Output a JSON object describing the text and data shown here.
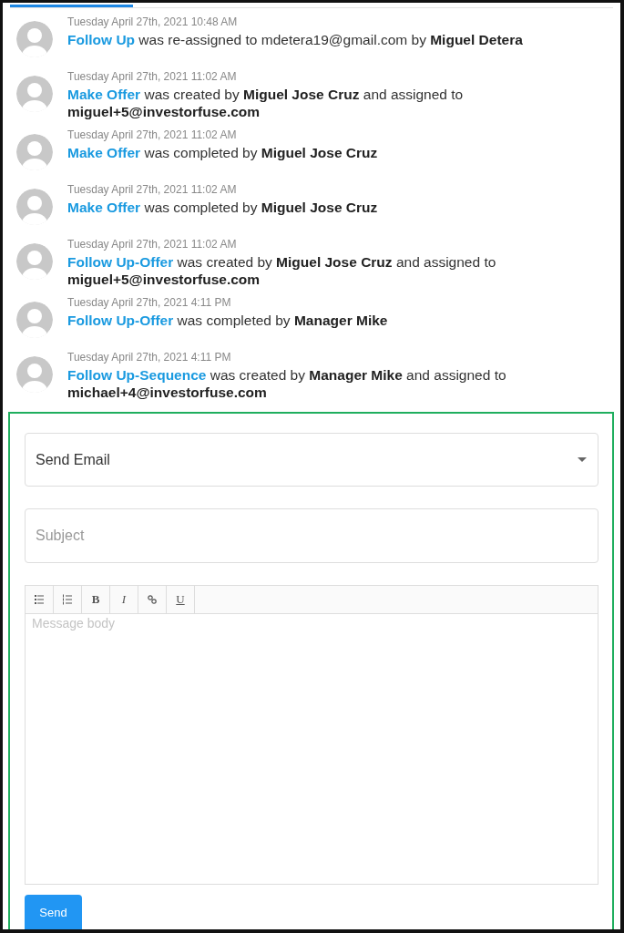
{
  "tab_indicator": {
    "selected": true
  },
  "activity": [
    {
      "time": "Tuesday April 27th, 2021 10:48 AM",
      "task": "Follow Up",
      "text": " was re-assigned to mdetera19@gmail.com by **Miguel Detera**"
    },
    {
      "time": "Tuesday April 27th, 2021 11:02 AM",
      "task": "Make Offer",
      "text": " was created by **Miguel Jose Cruz** and assigned to **miguel+5@investorfuse.com**"
    },
    {
      "time": "Tuesday April 27th, 2021 11:02 AM",
      "task": "Make Offer",
      "text": " was completed by **Miguel Jose Cruz**"
    },
    {
      "time": "Tuesday April 27th, 2021 11:02 AM",
      "task": "Make Offer",
      "text": " was completed by **Miguel Jose Cruz**"
    },
    {
      "time": "Tuesday April 27th, 2021 11:02 AM",
      "task": "Follow Up-Offer",
      "text": " was created by **Miguel Jose Cruz** and assigned to **miguel+5@investorfuse.com**"
    },
    {
      "time": "Tuesday April 27th, 2021 4:11 PM",
      "task": "Follow Up-Offer",
      "text": " was completed by **Manager Mike**"
    },
    {
      "time": "Tuesday April 27th, 2021 4:11 PM",
      "task": "Follow Up-Sequence",
      "text": " was created by **Manager Mike** and assigned to **michael+4@investorfuse.com**"
    }
  ],
  "form": {
    "action_select": {
      "value": "Send Email"
    },
    "subject": {
      "placeholder": "Subject"
    },
    "toolbar": [
      {
        "kind": "bullet-list"
      },
      {
        "kind": "numbered-list"
      },
      {
        "kind": "bold",
        "label": "B"
      },
      {
        "kind": "italic",
        "label": "I"
      },
      {
        "kind": "link"
      },
      {
        "kind": "underline",
        "label": "U"
      }
    ],
    "body": {
      "placeholder": "Message body"
    },
    "send_button": "Send"
  }
}
